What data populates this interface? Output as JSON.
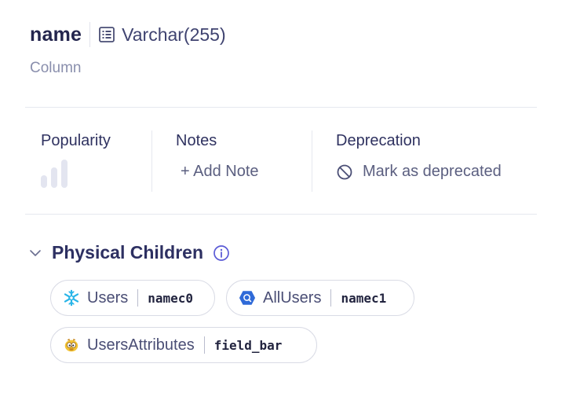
{
  "header": {
    "column_name": "name",
    "data_type": "Varchar(255)",
    "subtitle": "Column"
  },
  "stats": {
    "popularity_label": "Popularity",
    "popularity_level": 0,
    "notes_label": "Notes",
    "add_note_label": "+ Add Note",
    "deprecation_label": "Deprecation",
    "mark_deprecated_label": "Mark as deprecated"
  },
  "section": {
    "title": "Physical Children",
    "expanded": true
  },
  "children": [
    {
      "source": "Users",
      "source_icon": "snowflake-icon",
      "field": "namec0"
    },
    {
      "source": "AllUsers",
      "source_icon": "bigquery-icon",
      "field": "namec1"
    },
    {
      "source": "UsersAttributes",
      "source_icon": "hadoop-hive-icon",
      "field": "field_bar"
    }
  ],
  "colors": {
    "accent": "#5b5bd6",
    "popularity_bar": "#e3e5f0",
    "text_primary": "#23254d"
  }
}
